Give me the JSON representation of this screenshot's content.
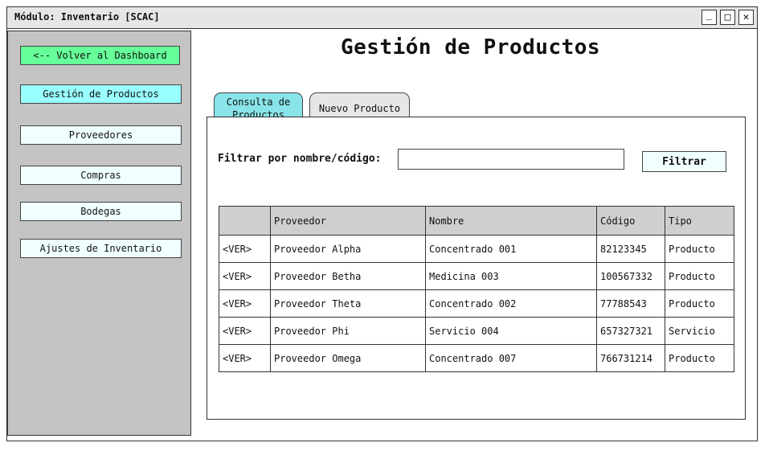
{
  "window": {
    "title": "Módulo: Inventario [SCAC]",
    "controls": {
      "minimize": "_",
      "maximize": "□",
      "close": "✕"
    }
  },
  "sidebar": {
    "items": [
      {
        "label": "<-- Volver al Dashboard",
        "style": "back",
        "color": "#66ff99"
      },
      {
        "label": "Gestión de Productos",
        "style": "active",
        "color": "#99ffff"
      },
      {
        "label": "Proveedores",
        "style": "normal"
      },
      {
        "label": "Compras",
        "style": "normal"
      },
      {
        "label": "Bodegas",
        "style": "normal"
      },
      {
        "label": "Ajustes de Inventario",
        "style": "normal"
      }
    ]
  },
  "main": {
    "title": "Gestión de Productos",
    "tabs": [
      {
        "label": "Consulta de Productos",
        "active": true
      },
      {
        "label": "Nuevo Producto",
        "active": false
      }
    ],
    "filter": {
      "label": "Filtrar por nombre/código:",
      "input_value": "",
      "button_label": "Filtrar"
    },
    "table": {
      "columns": [
        "",
        "Proveedor",
        "Nombre",
        "Código",
        "Tipo"
      ],
      "rows": [
        [
          "<VER>",
          "Proveedor Alpha",
          "Concentrado 001",
          "82123345",
          "Producto"
        ],
        [
          "<VER>",
          "Proveedor Betha",
          "Medicina 003",
          "100567332",
          "Producto"
        ],
        [
          "<VER>",
          "Proveedor Theta",
          "Concentrado 002",
          "77788543",
          "Producto"
        ],
        [
          "<VER>",
          "Proveedor Phi",
          "Servicio 004",
          "657327321",
          "Servicio"
        ],
        [
          "<VER>",
          "Proveedor Omega",
          "Concentrado 007",
          "766731214",
          "Producto"
        ]
      ]
    }
  }
}
